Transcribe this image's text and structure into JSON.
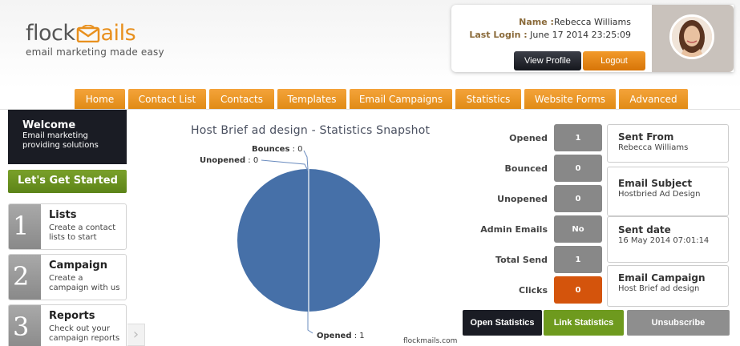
{
  "brand": {
    "logo_left": "flock",
    "logo_right": "ails",
    "tagline": "email marketing made easy",
    "accent": "#e8901e"
  },
  "user": {
    "name_label": "Name :",
    "name": "Rebecca Williams",
    "last_login_label": "Last Login :",
    "last_login": "June 17 2014 23:25:09",
    "view_profile": "View Profile",
    "logout": "Logout"
  },
  "nav": {
    "items": [
      "Home",
      "Contact List",
      "Contacts",
      "Templates",
      "Email Campaigns",
      "Statistics",
      "Website Forms",
      "Advanced"
    ]
  },
  "sidebar": {
    "welcome_title": "Welcome",
    "welcome_line1": "Email marketing",
    "welcome_line2": "providing solutions",
    "started": "Let's Get Started",
    "steps": [
      {
        "num": "1",
        "title": "Lists",
        "desc1": "Create a contact",
        "desc2": "lists to start"
      },
      {
        "num": "2",
        "title": "Campaign",
        "desc1": "Create a",
        "desc2": "campaign with us"
      },
      {
        "num": "3",
        "title": "Reports",
        "desc1": "Check out your",
        "desc2": "campaign reports"
      }
    ]
  },
  "chart_data": {
    "type": "pie",
    "title": "Host Brief ad design - Statistics Snapshot",
    "categories": [
      "Opened",
      "Bounces",
      "Unopened"
    ],
    "values": [
      1,
      0,
      0
    ],
    "colors": [
      "#4670a8",
      "#4670a8",
      "#4670a8"
    ]
  },
  "stats": {
    "opened_label": "Opened",
    "opened": "1",
    "bounced_label": "Bounced",
    "bounced": "0",
    "unopened_label": "Unopened",
    "unopened": "0",
    "admin_label": "Admin Emails",
    "admin": "No",
    "total_label": "Total Send",
    "total": "1",
    "clicks_label": "Clicks",
    "clicks": "0"
  },
  "info": {
    "sent_from_h": "Sent From",
    "sent_from": "Rebecca Williams",
    "subject_h": "Email Subject",
    "subject": "Hostbried Ad Design",
    "date_h": "Sent date",
    "date": "16 May 2014 07:01:14",
    "campaign_h": "Email Campaign",
    "campaign": "Host Brief ad design"
  },
  "actions": {
    "open_stats": "Open Statistics",
    "link_stats": "Link Statistics",
    "unsubscribe": "Unsubscribe"
  },
  "footer": {
    "url": "flockmails.com"
  }
}
